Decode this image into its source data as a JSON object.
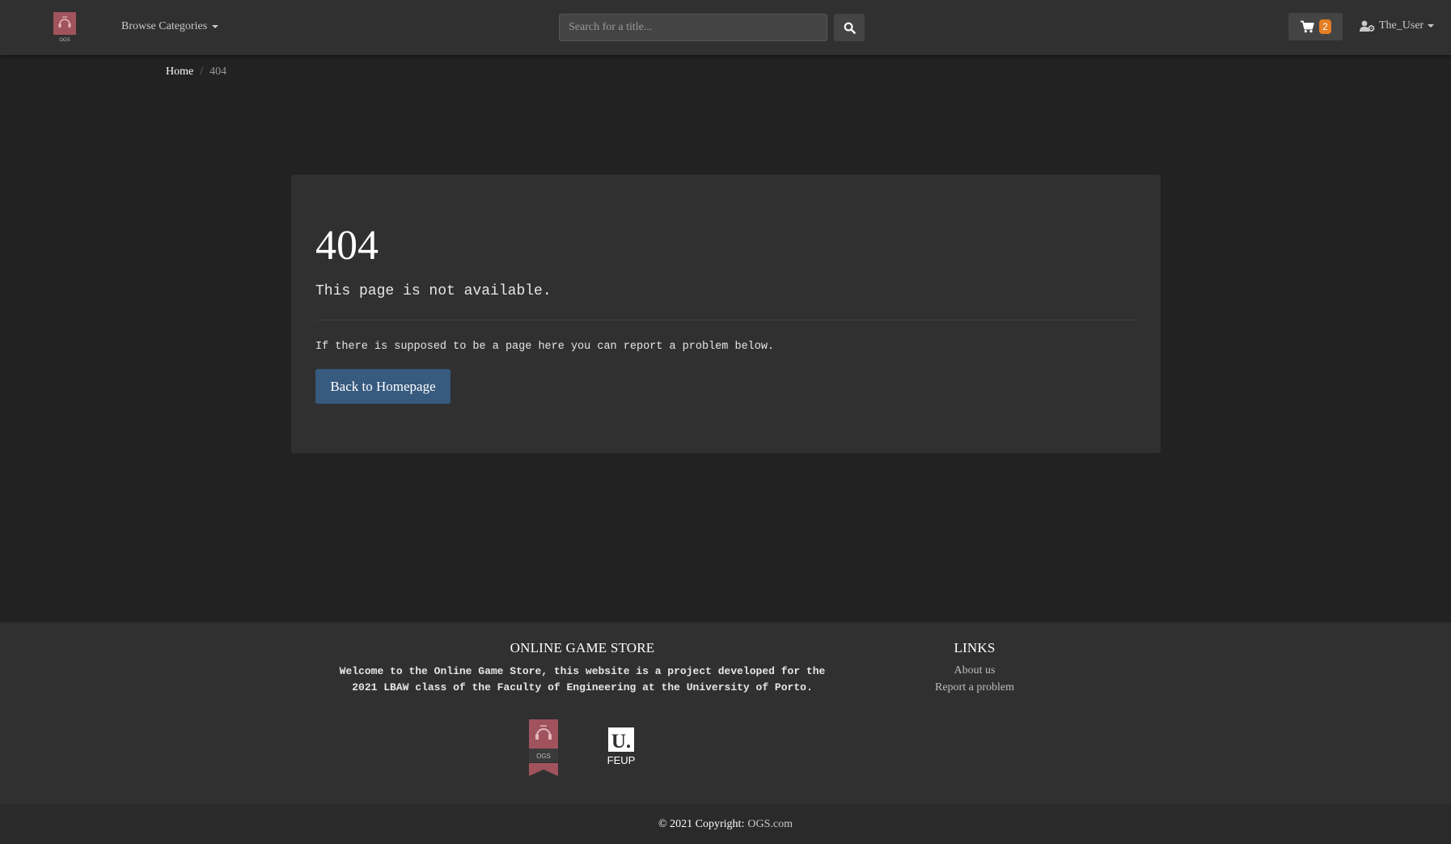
{
  "navbar": {
    "logo_text": "OGS",
    "browse_label": "Browse Categories",
    "search_placeholder": "Search for a title...",
    "cart_count": "2",
    "username": "The_User"
  },
  "breadcrumb": {
    "home": "Home",
    "separator": "/",
    "current": "404"
  },
  "error": {
    "code": "404",
    "message": "This page is not available.",
    "info": "If there is supposed to be a page here you can report a problem below.",
    "button_label": "Back to Homepage"
  },
  "footer": {
    "store_title": "ONLINE GAME STORE",
    "store_desc_line1": "Welcome to the Online Game Store, this website is a project developed for the",
    "store_desc_line2": "2021 LBAW class of the Faculty of Engineering at the University of Porto.",
    "links_title": "LINKS",
    "links": [
      "About us",
      "Report a problem"
    ],
    "ogs_logo_text": "OGS",
    "feup_mark": "U.",
    "feup_text": "FEUP",
    "copyright": "© 2021 Copyright:",
    "copyright_link": "OGS.com"
  },
  "colors": {
    "background": "#222222",
    "surface": "#303030",
    "primary": "#375a7f",
    "brand": "#a0535d",
    "badge": "#e67e22"
  },
  "icons": {
    "logo": "ogs-logo-icon",
    "search": "search-icon",
    "cart": "cart-icon",
    "user": "user-gear-icon"
  }
}
